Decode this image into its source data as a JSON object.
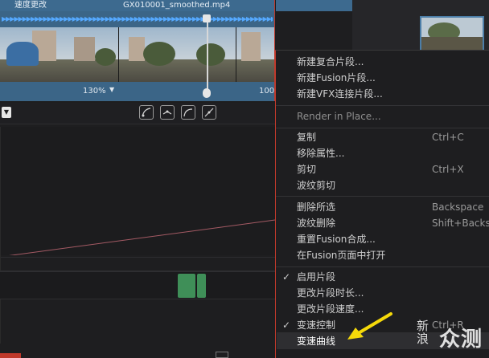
{
  "clip": {
    "speed_label": "速度更改",
    "filename": "GX010001_smoothed.mp4",
    "zoom_left": "130%",
    "zoom_right": "100",
    "speed_arrows": "▶▶▶▶▶▶▶▶▶▶▶▶▶▶▶▶▶▶▶▶▶▶▶▶▶▶▶▶▶▶▶▶▶▶▶▶▶▶▶▶▶▶▶▶▶▶▶▶▶▶▶▶▶▶▶▶▶▶▶▶▶▶▶▶▶▶▶▶▶▶▶▶"
  },
  "toolbar": {
    "dropdown_icon": "chevron-down-icon",
    "keyframe_buttons": [
      "curve-ease-in-icon",
      "curve-linear-icon",
      "curve-ease-out-icon",
      "curve-bezier-icon"
    ]
  },
  "context_menu": {
    "items": [
      {
        "label": "新建复合片段...",
        "shortcut": ""
      },
      {
        "label": "新建Fusion片段...",
        "shortcut": ""
      },
      {
        "label": "新建VFX连接片段...",
        "shortcut": ""
      },
      {
        "label": "Render in Place...",
        "shortcut": "",
        "disabled": true
      },
      {
        "label": "复制",
        "shortcut": "Ctrl+C"
      },
      {
        "label": "移除属性...",
        "shortcut": ""
      },
      {
        "label": "剪切",
        "shortcut": "Ctrl+X"
      },
      {
        "label": "波纹剪切",
        "shortcut": ""
      },
      {
        "label": "删除所选",
        "shortcut": "Backspace"
      },
      {
        "label": "波纹删除",
        "shortcut": "Shift+Backsp"
      },
      {
        "label": "重置Fusion合成...",
        "shortcut": ""
      },
      {
        "label": "在Fusion页面中打开",
        "shortcut": ""
      },
      {
        "label": "启用片段",
        "shortcut": "",
        "checked": true
      },
      {
        "label": "更改片段时长...",
        "shortcut": ""
      },
      {
        "label": "更改片段速度...",
        "shortcut": ""
      },
      {
        "label": "变速控制",
        "shortcut": "Ctrl+R",
        "checked": true
      },
      {
        "label": "变速曲线",
        "shortcut": "",
        "highlighted": true
      }
    ]
  },
  "watermark": {
    "logo": "新浪",
    "text": "众测"
  },
  "colors": {
    "accent_blue": "#3d6a8f",
    "keyframe_green": "#3f8f58",
    "arrow_yellow": "#f5d90a",
    "border_red": "#c0392b"
  }
}
